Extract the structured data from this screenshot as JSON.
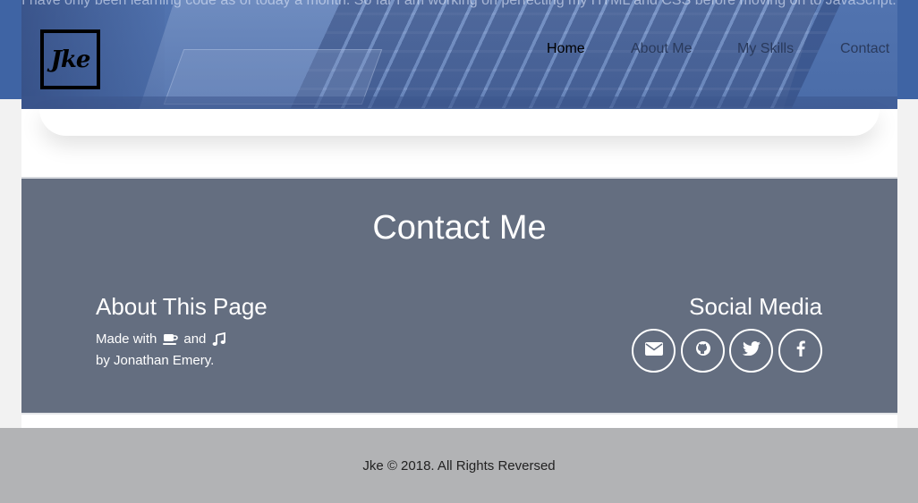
{
  "hero": {
    "text": "I have only been learning code as of today a month. So far I am working on perfecting my HTML and CSS before moving on to JavaScript."
  },
  "logo": {
    "text": "Jke"
  },
  "nav": {
    "items": [
      {
        "label": "Home",
        "active": true
      },
      {
        "label": "About Me",
        "active": false
      },
      {
        "label": "My Skills",
        "active": false
      },
      {
        "label": "Contact",
        "active": false
      }
    ]
  },
  "contact": {
    "title": "Contact Me",
    "about": {
      "heading": "About This Page",
      "made_with": "Made with",
      "and": "and",
      "byline": "by Jonathan Emery.",
      "icons": [
        "coffee-icon",
        "music-icon"
      ]
    },
    "social": {
      "heading": "Social Media",
      "icons": [
        "envelope-icon",
        "github-icon",
        "twitter-icon",
        "facebook-icon"
      ]
    }
  },
  "footer": {
    "text": "Jke © 2018. All Rights Reversed"
  },
  "colors": {
    "hero_blue": "#4c6ea9",
    "contact_bg": "#646e80",
    "footer_bg": "#b2b3b5",
    "page_bg": "#f2f2f2"
  }
}
